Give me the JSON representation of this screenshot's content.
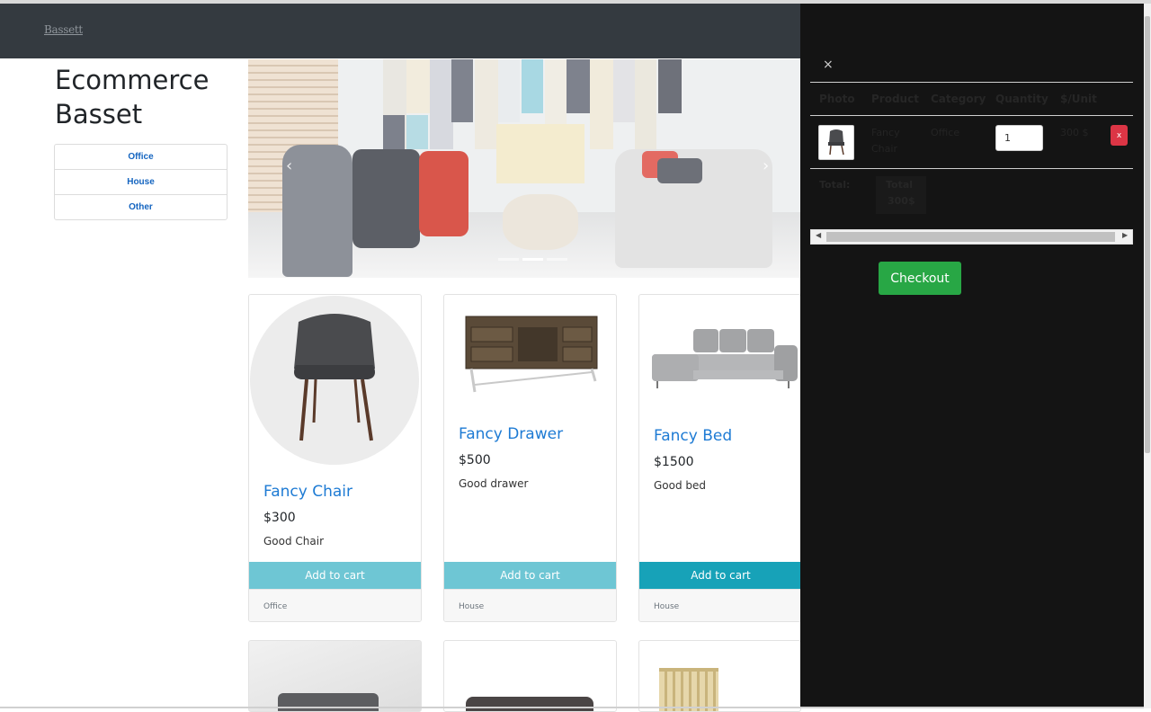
{
  "brand": "Bassett",
  "site_title_line1": "Ecommerce",
  "site_title_line2": "Basset",
  "categories": [
    "Office",
    "House",
    "Other"
  ],
  "carousel": {
    "prev_icon": "‹",
    "next_icon": "›",
    "slides": 3,
    "active_slide": 1
  },
  "products": [
    {
      "title": "Fancy Chair",
      "price": "$300",
      "description": "Good Chair",
      "button": "Add to cart",
      "category": "Office"
    },
    {
      "title": "Fancy Drawer",
      "price": "$500",
      "description": "Good drawer",
      "button": "Add to cart",
      "category": "House"
    },
    {
      "title": "Fancy Bed",
      "price": "$1500",
      "description": "Good bed",
      "button": "Add to cart",
      "category": "House"
    }
  ],
  "cart": {
    "close": "×",
    "headers": {
      "photo": "Photo",
      "product": "Product",
      "category": "Category",
      "quantity": "Quantity",
      "unit": "$/Unit"
    },
    "item": {
      "product_line1": "Fancy",
      "product_line2": "Chair",
      "category": "Office",
      "quantity": "1",
      "unit_price": "300 $",
      "remove": "x"
    },
    "total_label": "Total:",
    "total_value_line1": "Total",
    "total_value_line2": "300$",
    "checkout": "Checkout"
  },
  "colors": {
    "navbar": "#343a40",
    "link": "#1e7bd4",
    "add_to_cart": "#6ec6d4",
    "add_to_cart_hover": "#17a2b8",
    "checkout": "#28a745",
    "remove": "#dc3545",
    "cart_panel": "#141414"
  }
}
